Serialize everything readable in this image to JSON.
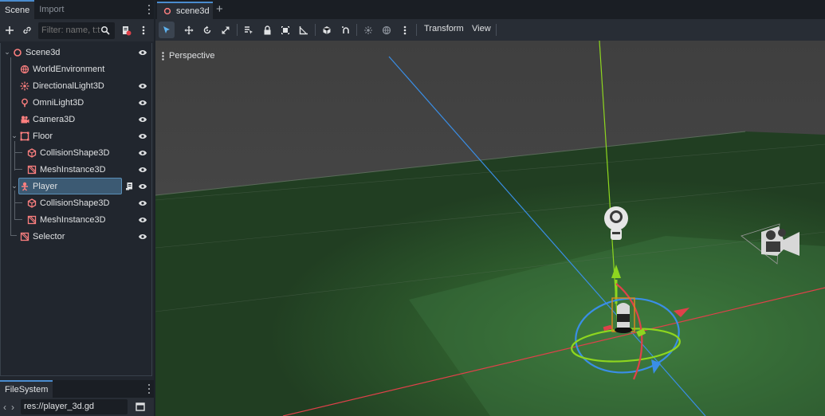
{
  "scene_dock": {
    "tabs": [
      "Scene",
      "Import"
    ],
    "filter_placeholder": "Filter: name, t:type, g:group"
  },
  "tree": [
    {
      "label": "Scene3d",
      "icon": "node3d-icon",
      "visible": true
    },
    {
      "label": "WorldEnvironment",
      "icon": "world-environment-icon",
      "visible": false
    },
    {
      "label": "DirectionalLight3D",
      "icon": "directional-light-icon",
      "visible": true
    },
    {
      "label": "OmniLight3D",
      "icon": "omni-light-icon",
      "visible": true
    },
    {
      "label": "Camera3D",
      "icon": "camera-icon",
      "visible": true
    },
    {
      "label": "Floor",
      "icon": "static-body-icon",
      "visible": true
    },
    {
      "label": "CollisionShape3D",
      "icon": "collision-shape-icon",
      "visible": true
    },
    {
      "label": "MeshInstance3D",
      "icon": "mesh-instance-icon",
      "visible": true
    },
    {
      "label": "Player",
      "icon": "character-body-icon",
      "visible": true,
      "selected": true,
      "has_script": true
    },
    {
      "label": "CollisionShape3D",
      "icon": "collision-shape-icon",
      "visible": true
    },
    {
      "label": "MeshInstance3D",
      "icon": "mesh-instance-icon",
      "visible": true
    },
    {
      "label": "Selector",
      "icon": "mesh-instance-icon",
      "visible": true
    }
  ],
  "filesystem": {
    "tab": "FileSystem",
    "path": "res://player_3d.gd"
  },
  "editor": {
    "tab": "scene3d",
    "menus": [
      "Transform",
      "View"
    ],
    "viewport_label": "Perspective"
  },
  "colors": {
    "accent": "#4a8ccf",
    "node3d": "#fc7f7f",
    "axis_x": "#e0414a",
    "axis_y": "#8ed61f",
    "axis_z": "#3a8ee6"
  }
}
